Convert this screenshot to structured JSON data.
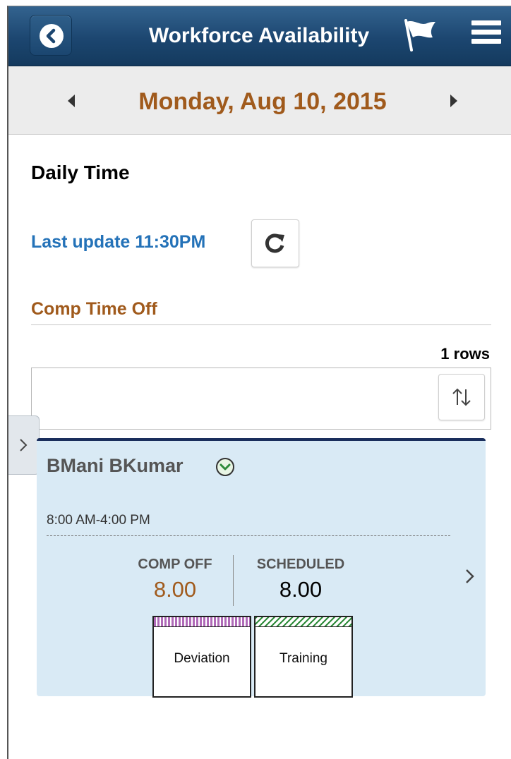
{
  "header": {
    "title": "Workforce Availability",
    "back_icon": "back-chevron-icon",
    "flag_icon": "flag-icon",
    "menu_icon": "hamburger-menu-icon"
  },
  "datebar": {
    "date": "Monday, Aug 10, 2015",
    "prev_icon": "triangle-left-icon",
    "next_icon": "triangle-right-icon"
  },
  "page": {
    "section_title": "Daily Time",
    "last_update": "Last update 11:30PM",
    "refresh_icon": "refresh-icon",
    "group_title": "Comp Time Off",
    "rows_count": "1 rows",
    "sort_icon": "sort-icon"
  },
  "card": {
    "employee_name": "BMani BKumar",
    "shift": "8:00 AM-4:00 PM",
    "metrics": [
      {
        "label": "COMP OFF",
        "value": "8.00"
      },
      {
        "label": "SCHEDULED",
        "value": "8.00"
      }
    ],
    "tiles": [
      {
        "label": "Deviation",
        "strip_color": "#b06ab8"
      },
      {
        "label": "Training",
        "strip_color": "#2e8b3a"
      }
    ]
  },
  "colors": {
    "header_bg": "#1c4670",
    "accent_orange": "#a05a1c",
    "link_blue": "#2472b8",
    "card_bg": "#d9eaf5",
    "card_border": "#1a2e5c"
  }
}
